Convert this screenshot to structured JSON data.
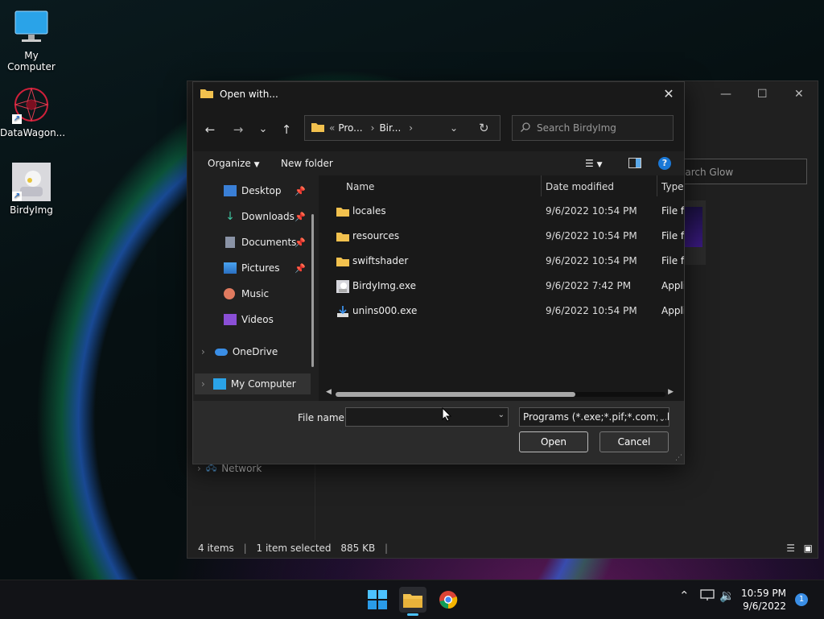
{
  "desktop": {
    "icons": [
      {
        "label": "My Computer"
      },
      {
        "label": "DataWagon..."
      },
      {
        "label": "BirdyImg"
      }
    ]
  },
  "background_window": {
    "search_placeholder": "earch Glow",
    "nav_network": "Network",
    "status": {
      "items": "4 items",
      "selected": "1 item selected",
      "size": "885 KB"
    },
    "controls": {
      "minimize": "—",
      "maximize": "☐",
      "close": "✕"
    }
  },
  "dialog": {
    "title": "Open with...",
    "nav": {
      "back": "←",
      "forward": "→",
      "recent": "⌄",
      "up": "↑",
      "refresh": "↻"
    },
    "address": {
      "overflow": "«",
      "crumbs": [
        "Pro...",
        "Bir..."
      ]
    },
    "search_placeholder": "Search BirdyImg",
    "commands": {
      "organize": "Organize",
      "new_folder": "New folder"
    },
    "sidebar": [
      {
        "label": "Desktop",
        "icon": "desktop-icon",
        "pinned": true
      },
      {
        "label": "Downloads",
        "icon": "downloads-icon",
        "pinned": true
      },
      {
        "label": "Documents",
        "icon": "documents-icon",
        "pinned": true
      },
      {
        "label": "Pictures",
        "icon": "pictures-icon",
        "pinned": true
      },
      {
        "label": "Music",
        "icon": "music-icon",
        "pinned": false
      },
      {
        "label": "Videos",
        "icon": "videos-icon",
        "pinned": false
      },
      {
        "label": "OneDrive",
        "icon": "onedrive-icon",
        "pinned": false
      },
      {
        "label": "My Computer",
        "icon": "computer-icon",
        "pinned": false,
        "selected": true
      }
    ],
    "columns": {
      "name": "Name",
      "date": "Date modified",
      "type": "Type"
    },
    "files": [
      {
        "name": "locales",
        "date": "9/6/2022 10:54 PM",
        "type": "File fo",
        "icon": "folder-icon"
      },
      {
        "name": "resources",
        "date": "9/6/2022 10:54 PM",
        "type": "File fo",
        "icon": "folder-icon"
      },
      {
        "name": "swiftshader",
        "date": "9/6/2022 10:54 PM",
        "type": "File fo",
        "icon": "folder-icon"
      },
      {
        "name": "BirdyImg.exe",
        "date": "9/6/2022 7:42 PM",
        "type": "Appli",
        "icon": "exe-icon"
      },
      {
        "name": "unins000.exe",
        "date": "9/6/2022 10:54 PM",
        "type": "Appli",
        "icon": "installer-icon"
      }
    ],
    "file_name_label": "File name:",
    "file_name_value": "",
    "file_type": "Programs (*.exe;*.pif;*.com;*.ba",
    "buttons": {
      "open": "Open",
      "cancel": "Cancel"
    }
  },
  "taskbar": {
    "clock_time": "10:59 PM",
    "clock_date": "9/6/2022",
    "notification_count": "1"
  },
  "colors": {
    "accent": "#3a8ee6",
    "folder": "#f2c14e",
    "dialog_bg": "#191919"
  }
}
